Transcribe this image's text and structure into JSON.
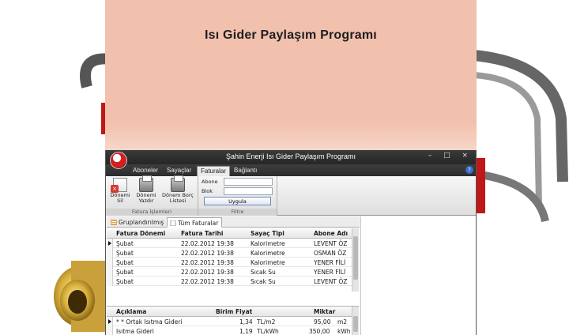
{
  "banner": {
    "title": "Isı Gider Paylaşım Programı"
  },
  "window": {
    "title": "Şahin Enerji Isı Gider Paylaşım Programı",
    "controls": [
      "–",
      "□",
      "×"
    ],
    "help_label": "?"
  },
  "ribbon_tabs": [
    "Aboneler",
    "Sayaçlar",
    "Faturalar",
    "Bağlantı"
  ],
  "ribbon": {
    "invoice_group": {
      "caption": "Fatura İşlemleri",
      "buttons": [
        {
          "label1": "Dönemi",
          "label2": "Sil",
          "icon": "delete-doc-icon"
        },
        {
          "label1": "Dönemi",
          "label2": "Yazdır",
          "icon": "printer-icon"
        },
        {
          "label1": "Dönem Borç",
          "label2": "Listesi",
          "icon": "printer-icon"
        }
      ]
    },
    "filter_group": {
      "caption": "Filtre",
      "abone_label": "Abone",
      "blok_label": "Blok",
      "abone_value": "",
      "blok_value": "",
      "apply_label": "Uygula"
    }
  },
  "subtabs": [
    "Gruplandırılmış",
    "Tüm Faturalar"
  ],
  "invoices": {
    "columns": [
      "Fatura Dönemi",
      "Fatura Tarihi",
      "Sayaç Tipi",
      "Abone Adı"
    ],
    "rows": [
      [
        "Şubat",
        "22.02.2012 19:38",
        "Kalorimetre",
        "LEVENT ÖZ"
      ],
      [
        "Şubat",
        "22.02.2012 19:38",
        "Kalorimetre",
        "OSMAN ÖZ"
      ],
      [
        "Şubat",
        "22.02.2012 19:38",
        "Kalorimetre",
        "YENER FİLİ"
      ],
      [
        "Şubat",
        "22.02.2012 19:38",
        "Sıcak Su",
        "YENER FİLİ"
      ],
      [
        "Şubat",
        "22.02.2012 19:38",
        "Sıcak Su",
        "LEVENT ÖZ"
      ]
    ]
  },
  "details": {
    "columns": [
      "Açıklama",
      "Birim Fiyat",
      "Miktar"
    ],
    "rows": [
      [
        "* * Ortak Isıtma Gideri",
        "1,34",
        "TL/m2",
        "95,00",
        "m2"
      ],
      [
        "Isıtma Gideri",
        "1,19",
        "TL/kWh",
        "350,00",
        "kWh"
      ]
    ]
  }
}
